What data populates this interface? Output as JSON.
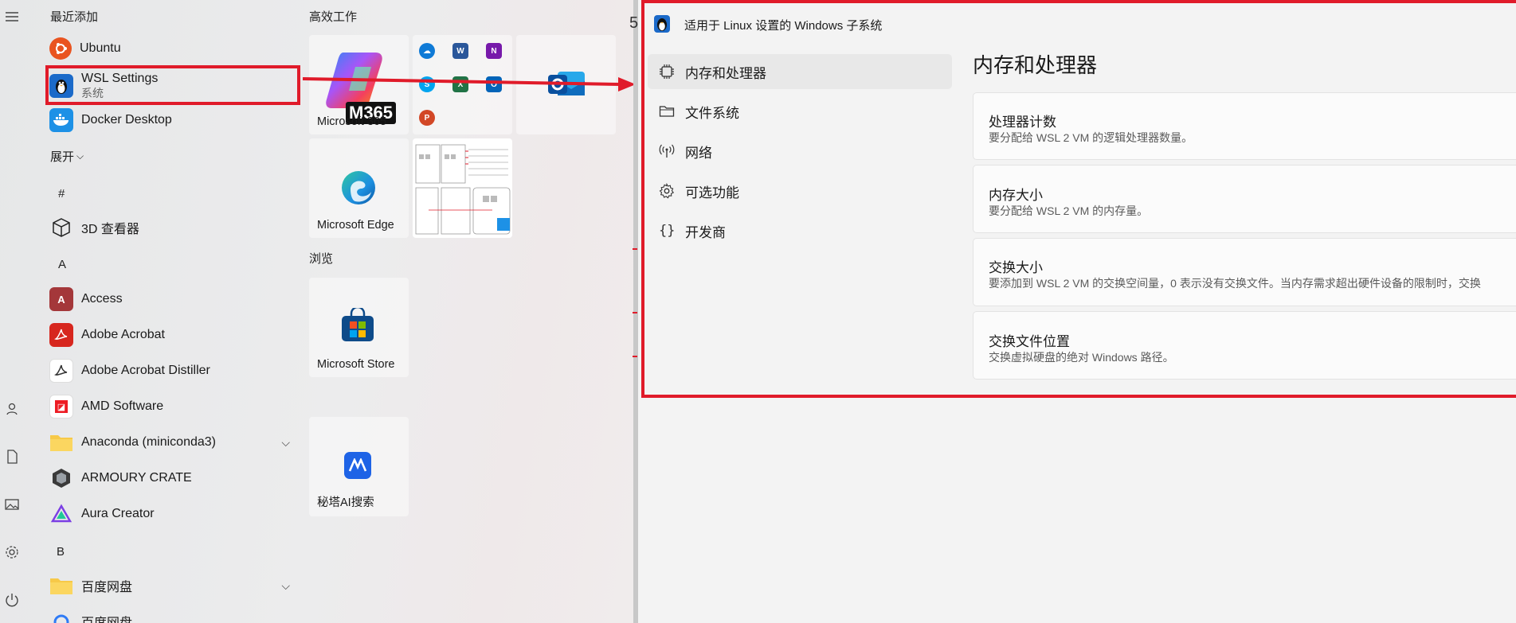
{
  "start_menu": {
    "recent_header": "最近添加",
    "expand_label": "展开",
    "recent_apps": [
      {
        "name": "Ubuntu",
        "icon": "ubuntu-icon",
        "color": "#e95420"
      },
      {
        "name": "WSL Settings",
        "subtitle": "系统",
        "icon": "wsl-penguin-icon",
        "color": "#1b6ac9"
      },
      {
        "name": "Docker Desktop",
        "icon": "docker-icon",
        "color": "#1d91e6"
      }
    ],
    "letters": {
      "hash": "#",
      "a": "A",
      "b": "B"
    },
    "apps": [
      {
        "name": "3D 查看器",
        "icon": "cube-icon"
      },
      {
        "name": "Access",
        "icon": "access-icon",
        "color": "#a4373a"
      },
      {
        "name": "Adobe Acrobat",
        "icon": "acrobat-icon",
        "color": "#d7261e"
      },
      {
        "name": "Adobe Acrobat Distiller",
        "icon": "distiller-icon"
      },
      {
        "name": "AMD Software",
        "icon": "amd-icon",
        "color": "#ed1c24"
      },
      {
        "name": "Anaconda (miniconda3)",
        "icon": "folder-icon",
        "color": "#f7c948"
      },
      {
        "name": "ARMOURY CRATE",
        "icon": "armoury-crate-icon"
      },
      {
        "name": "Aura Creator",
        "icon": "aura-icon"
      },
      {
        "name": "百度网盘",
        "icon": "folder-icon",
        "color": "#f7c948"
      },
      {
        "name": "百度网盘",
        "icon": "baidu-netdisk-icon"
      }
    ],
    "pinned": {
      "productivity_header": "高效工作",
      "browse_header": "浏览",
      "tiles": [
        {
          "label": "Microsoft 365",
          "badge": "M365"
        },
        {
          "label": "Microsoft Edge"
        },
        {
          "label": "Microsoft Store"
        },
        {
          "label": "秘塔AI搜索"
        }
      ]
    }
  },
  "wsl_window": {
    "title": "适用于 Linux 设置的 Windows 子系统",
    "nav": [
      {
        "label": "内存和处理器",
        "icon": "chip-icon",
        "selected": true
      },
      {
        "label": "文件系统",
        "icon": "folder-outline-icon"
      },
      {
        "label": "网络",
        "icon": "antenna-icon"
      },
      {
        "label": "可选功能",
        "icon": "gear-icon"
      },
      {
        "label": "开发商",
        "icon": "braces-icon"
      }
    ],
    "page_title": "内存和处理器",
    "cards": [
      {
        "title": "处理器计数",
        "desc": "要分配给 WSL 2 VM 的逻辑处理器数量。"
      },
      {
        "title": "内存大小",
        "desc": "要分配给 WSL 2 VM 的内存量。"
      },
      {
        "title": "交换大小",
        "desc": "要添加到 WSL 2 VM 的交换空间量，0 表示没有交换文件。当内存需求超出硬件设备的限制时，交换"
      },
      {
        "title": "交换文件位置",
        "desc": "交换虚拟硬盘的绝对 Windows 路径。"
      }
    ]
  },
  "colors": {
    "highlight": "#e01b2a",
    "accent": "#0067c0"
  }
}
